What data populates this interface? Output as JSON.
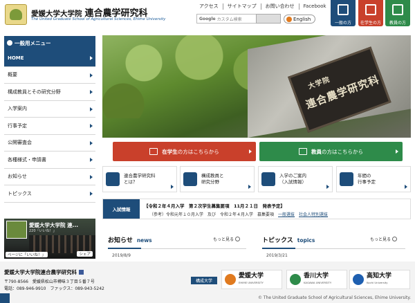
{
  "header": {
    "title_small": "愛媛大学大学院",
    "title_big": "連合農学研究科",
    "subtitle": "The United Graduate School of Agricultural Sciences, Ehime University",
    "util_links": [
      "アクセス",
      "サイトマップ",
      "お問い合わせ",
      "Facebook"
    ],
    "search_brand": "Google",
    "search_placeholder": "カスタム検索",
    "lang_label": "English",
    "audience": {
      "general": "一般の方",
      "student": "在学生の方",
      "faculty": "教員の方"
    }
  },
  "sidebar": {
    "heading": "一般用メニュー",
    "items": [
      {
        "label": "HOME",
        "active": true
      },
      {
        "label": "概要"
      },
      {
        "label": "構成教員とその研究分野"
      },
      {
        "label": "入学案内"
      },
      {
        "label": "行事予定"
      },
      {
        "label": "公開審査会"
      },
      {
        "label": "各種様式・申請書"
      },
      {
        "label": "お知らせ"
      },
      {
        "label": "トピックス"
      }
    ]
  },
  "facebook": {
    "title": "愛媛大学大学院 連...",
    "likes": "220「いいね！」",
    "like_button": "ページに「いいね！」",
    "share_button": "シェア"
  },
  "hero": {
    "plaque_line1": "大学院",
    "plaque_line2": "連合農学研究科"
  },
  "big_buttons": {
    "student_bold": "在学生",
    "student_rest": "の方はこちらから",
    "faculty_bold": "教員",
    "faculty_rest": "の方はこちらから"
  },
  "quick_links": [
    {
      "line1": "連合農学研究科",
      "line2": "とは？",
      "icon": "building-icon"
    },
    {
      "line1": "構成教員と",
      "line2": "研究分野",
      "icon": "flask-icon"
    },
    {
      "line1": "入学のご案内",
      "line2": "（入試情報）",
      "icon": "pencil-icon"
    },
    {
      "line1": "年間の",
      "line2": "行事予定",
      "icon": "calendar-icon"
    }
  ],
  "ticker": {
    "label": "入試情報",
    "line1": "【令和２年４月入学　第２次学生募集要項　11月２１日　発表予定】",
    "line2_prefix": "（参考）令和元年１０月入学　及び　令和２年４月入学　募集要項　",
    "link1": "一般選抜",
    "link2": "社会人特別選抜"
  },
  "news": {
    "heading": "お知らせ",
    "heading_en": "news",
    "more": "もっと見る",
    "date": "2019/8/9"
  },
  "topics": {
    "heading": "トピックス",
    "heading_en": "topics",
    "more": "もっと見る",
    "date": "2019/3/21"
  },
  "footer": {
    "name": "愛媛大学大学院連合農学研究科",
    "address": "〒790-8566　愛媛県松山市樽味３丁目５番７号",
    "tel": "電話：089-946-9910　ファックス：089-943-5242",
    "constituent_label": "構成大学",
    "universities": [
      {
        "name": "愛媛大学",
        "en": "EHIME UNIVERSITY"
      },
      {
        "name": "香川大学",
        "en": "KAGAWA UNIVERSITY"
      },
      {
        "name": "高知大学",
        "en": "Kochi University"
      }
    ],
    "copyright": "© The United Graduate School of Agricultural Sciences, Ehime University."
  },
  "colors": {
    "primary": "#1e4d7a",
    "student": "#c9402b",
    "faculty": "#2e8b4a",
    "english": "#e07a1f"
  }
}
